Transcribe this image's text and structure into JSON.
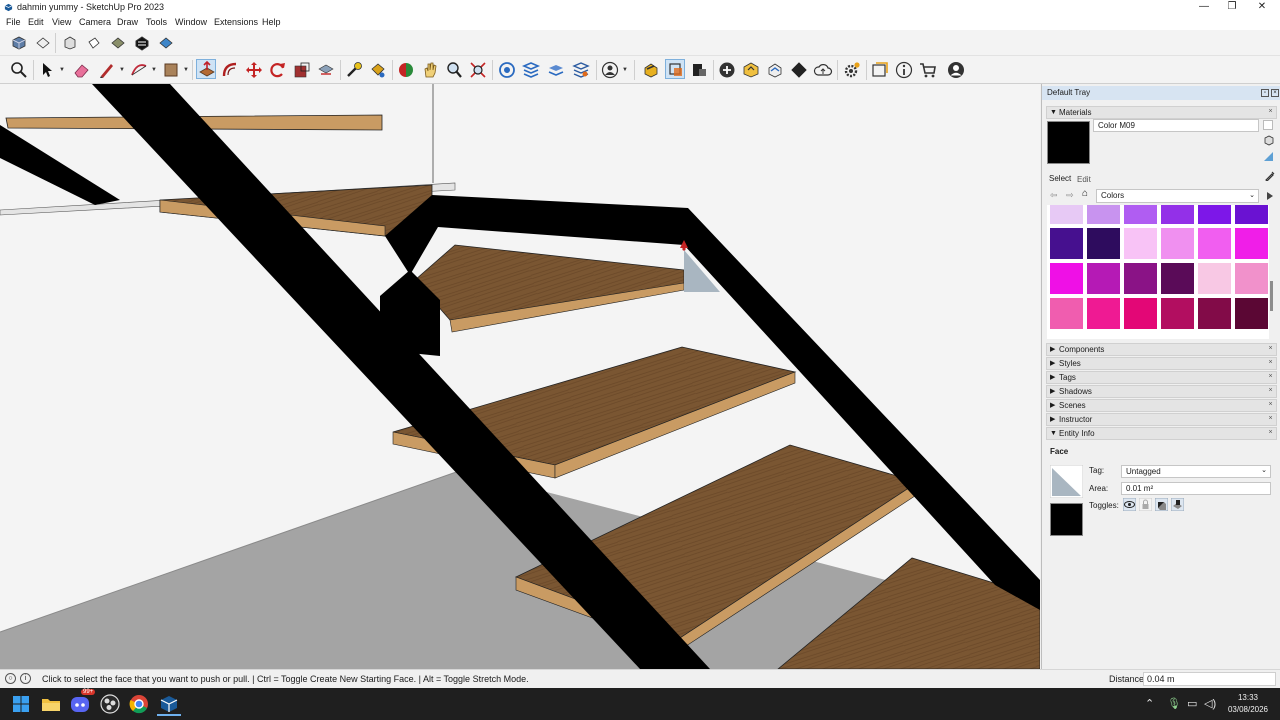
{
  "window": {
    "title": "dahmin yummy - SketchUp Pro 2023",
    "controls": [
      "minimize-icon",
      "restore-icon",
      "close-icon"
    ]
  },
  "menu": [
    "File",
    "Edit",
    "View",
    "Camera",
    "Draw",
    "Tools",
    "Window",
    "Extensions",
    "Help"
  ],
  "tray": {
    "title": "Default Tray",
    "materials": {
      "header": "Materials",
      "material_name": "Color M09",
      "tabs": [
        "Select",
        "Edit"
      ],
      "collection": "Colors",
      "swatches": [
        [
          "#e7c9f5",
          "#c893ef",
          "#b05df2",
          "#9330e8",
          "#7d17e8",
          "#6a12d2"
        ],
        [
          "#46108f",
          "#2e0c5e",
          "#f8c3f6",
          "#f090f0",
          "#f15ef0",
          "#f01ee8"
        ],
        [
          "#ef10e6",
          "#b51ab5",
          "#8a1386",
          "#5a0b58",
          "#f8c8e4",
          "#f191cb"
        ],
        [
          "#f05daf",
          "#ef1a93",
          "#e30776",
          "#b20e60",
          "#820b48",
          "#5b0734"
        ]
      ]
    },
    "panels": [
      "Components",
      "Styles",
      "Tags",
      "Shadows",
      "Scenes",
      "Instructor",
      "Entity Info"
    ],
    "entity_info": {
      "type": "Face",
      "tag_label": "Tag:",
      "tag_value": "Untagged",
      "area_label": "Area:",
      "area_value": "0.01 m²",
      "toggles_label": "Toggles:"
    }
  },
  "status": {
    "message": "Click to select the face that you want to push or pull. | Ctrl = Toggle Create New Starting Face. | Alt = Toggle Stretch Mode.",
    "measurement_label": "Distance",
    "measurement_value": "0.04 m"
  },
  "taskbar": {
    "time": "13:33",
    "date": "03/08/2026",
    "badge": "99+"
  },
  "colors": {
    "tray_title": "#d7e4f2",
    "wood": "#7a5632",
    "wood_edge": "#c99b63",
    "stringer": "#000000",
    "floor": "#a4a4a4",
    "selected_face": "#a9b6c1"
  }
}
